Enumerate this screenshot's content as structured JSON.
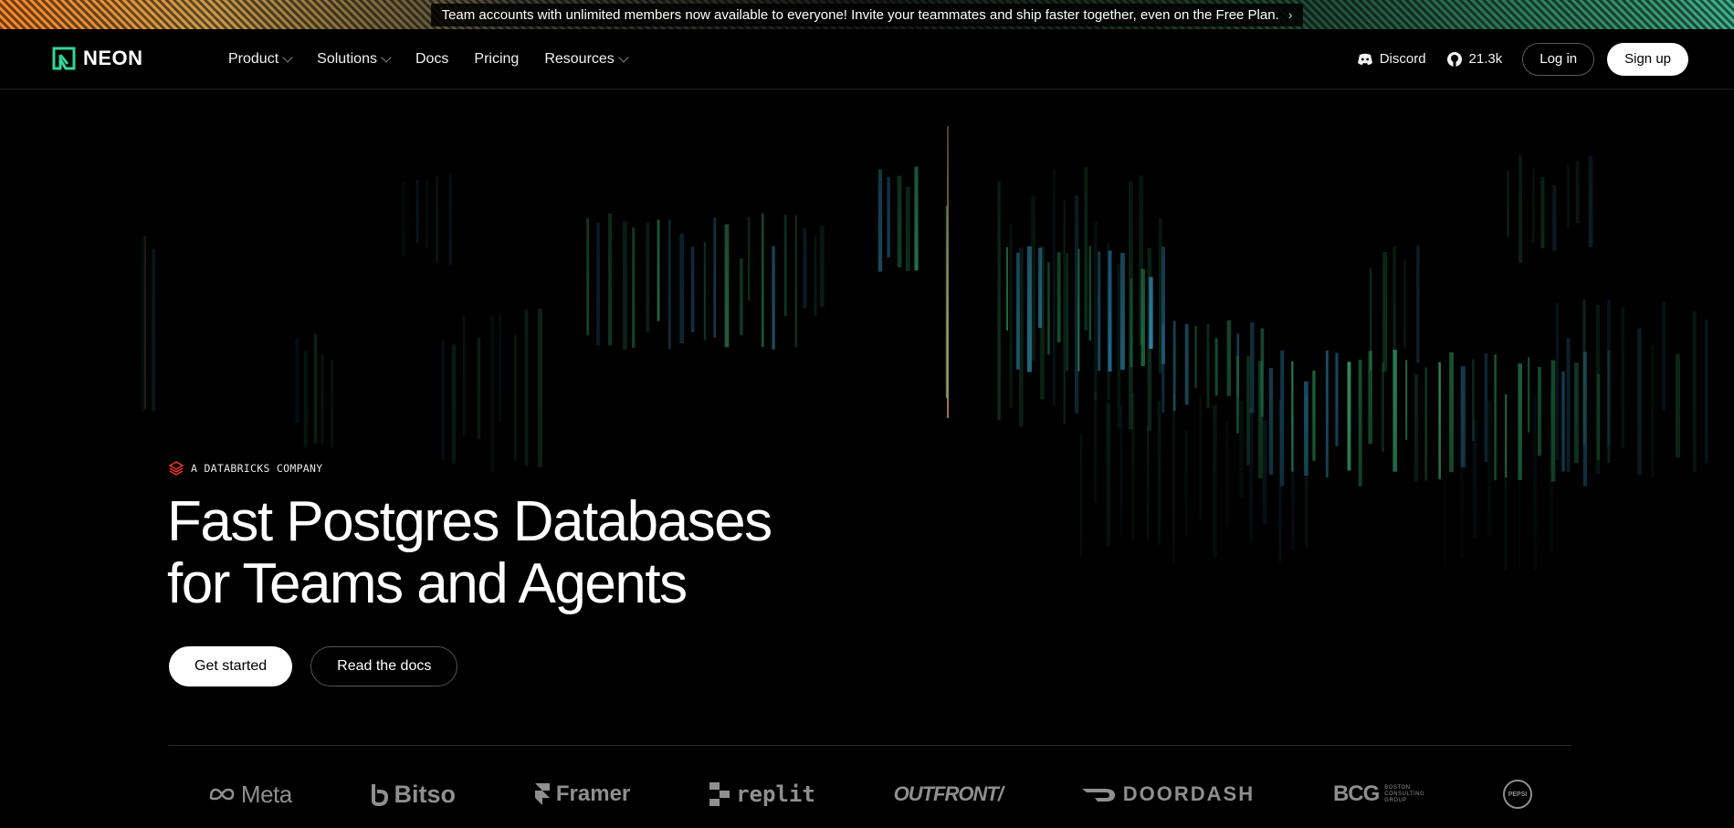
{
  "announcement": {
    "text": "Team accounts with unlimited members now available to everyone! Invite your teammates and ship faster together, even on the Free Plan.",
    "chevron": "›"
  },
  "nav": {
    "logo_text": "NEON",
    "links": [
      {
        "label": "Product",
        "has_dropdown": true
      },
      {
        "label": "Solutions",
        "has_dropdown": true
      },
      {
        "label": "Docs",
        "has_dropdown": false
      },
      {
        "label": "Pricing",
        "has_dropdown": false
      },
      {
        "label": "Resources",
        "has_dropdown": true
      }
    ],
    "discord_label": "Discord",
    "github_stars": "21.3k",
    "login_label": "Log in",
    "signup_label": "Sign up"
  },
  "hero": {
    "eyebrow": "A DATABRICKS COMPANY",
    "headline_line1": "Fast Postgres Databases",
    "headline_line2": "for Teams and Agents",
    "primary_cta": "Get started",
    "secondary_cta": "Read the docs"
  },
  "logos": {
    "meta": "Meta",
    "bitso": "Bitso",
    "framer": "Framer",
    "replit": "replit",
    "outfront": "OUTFRONT/",
    "doordash": "DOORDASH",
    "bcg": "BCG",
    "bcg_sub": [
      "BOSTON",
      "CONSULTING",
      "GROUP"
    ],
    "pepsi": "PEPSI"
  },
  "colors": {
    "brand_green": "#34d59a",
    "background": "#000000",
    "databricks_red": "#ff3621"
  }
}
